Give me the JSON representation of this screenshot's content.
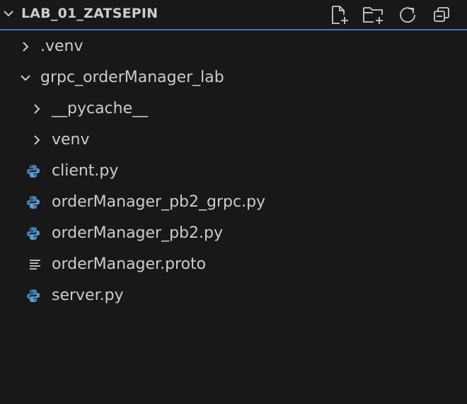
{
  "explorer": {
    "title": "LAB_01_ZATSEPIN",
    "actions": [
      {
        "name": "new-file-button",
        "icon": "new-file-icon"
      },
      {
        "name": "new-folder-button",
        "icon": "new-folder-icon"
      },
      {
        "name": "refresh-button",
        "icon": "refresh-icon"
      },
      {
        "name": "collapse-all-button",
        "icon": "collapse-all-icon"
      }
    ],
    "accent_color": "#2f7ad0",
    "items": [
      {
        "label": ".venv",
        "type": "folder",
        "expanded": false,
        "depth": 0
      },
      {
        "label": "grpc_orderManager_lab",
        "type": "folder",
        "expanded": true,
        "depth": 0
      },
      {
        "label": "__pycache__",
        "type": "folder",
        "expanded": false,
        "depth": 1
      },
      {
        "label": "venv",
        "type": "folder",
        "expanded": false,
        "depth": 1
      },
      {
        "label": "client.py",
        "type": "python",
        "depth": 1
      },
      {
        "label": "orderManager_pb2_grpc.py",
        "type": "python",
        "depth": 1
      },
      {
        "label": "orderManager_pb2.py",
        "type": "python",
        "depth": 1
      },
      {
        "label": "orderManager.proto",
        "type": "text",
        "depth": 1
      },
      {
        "label": "server.py",
        "type": "python",
        "depth": 1
      }
    ]
  }
}
